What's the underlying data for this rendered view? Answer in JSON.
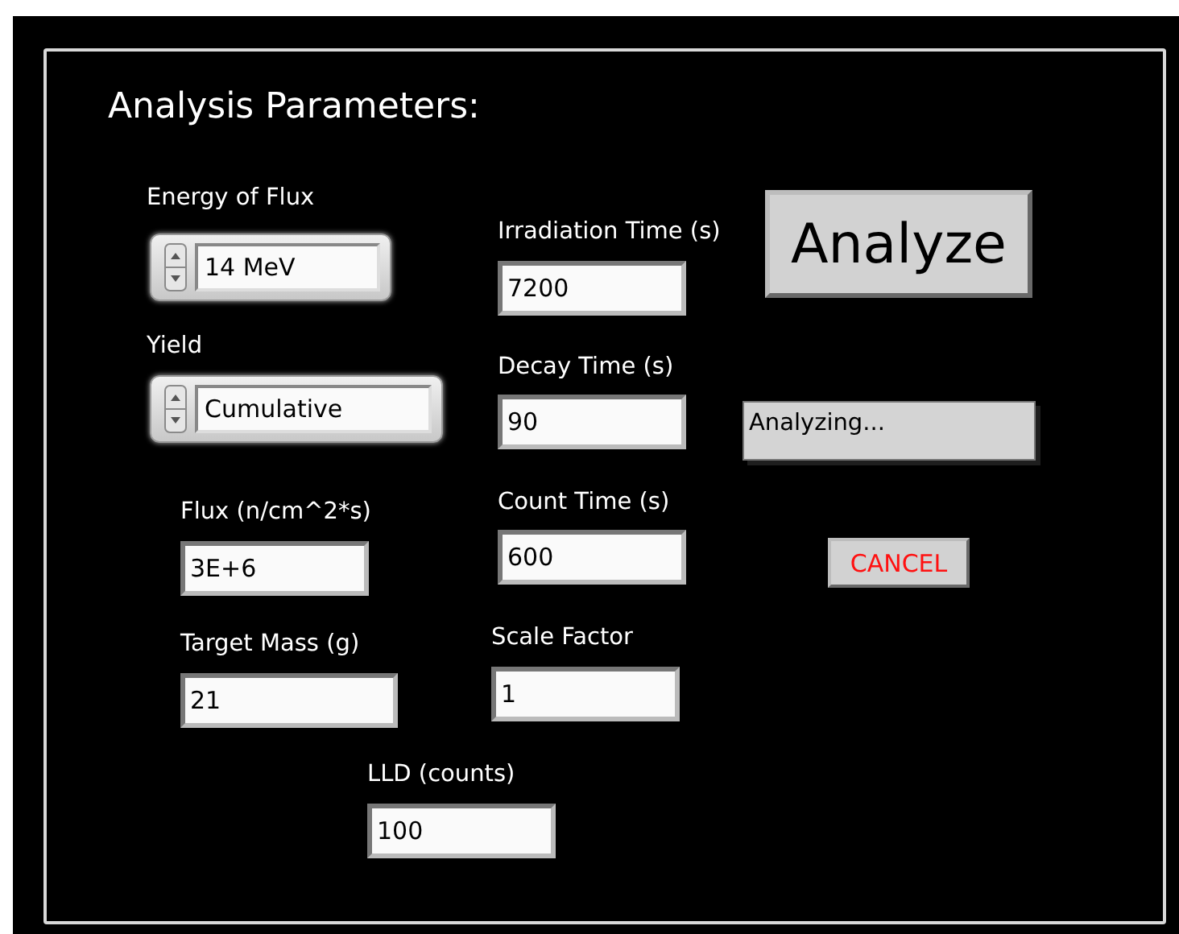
{
  "panel": {
    "title": "Analysis Parameters:"
  },
  "controls": [
    {
      "kind": "ring",
      "label": "Energy of Flux",
      "value": "14 MeV"
    },
    {
      "kind": "ring",
      "label": "Yield",
      "value": "Cumulative"
    },
    {
      "kind": "numeric",
      "label": "Irradiation Time (s)",
      "value": "7200"
    },
    {
      "kind": "numeric",
      "label": "Decay Time (s)",
      "value": "90"
    },
    {
      "kind": "numeric",
      "label": "Flux (n/cm^2*s)",
      "value": "3E+6"
    },
    {
      "kind": "numeric",
      "label": "Count Time (s)",
      "value": "600"
    },
    {
      "kind": "numeric",
      "label": "Target Mass (g)",
      "value": "21"
    },
    {
      "kind": "numeric",
      "label": "Scale Factor",
      "value": "1"
    },
    {
      "kind": "numeric",
      "label": "LLD (counts)",
      "value": "100"
    }
  ],
  "analyze_button": {
    "label": "Analyze"
  },
  "status_indicator": {
    "value": "Analyzing..."
  },
  "cancel_button": {
    "label": "CANCEL"
  }
}
